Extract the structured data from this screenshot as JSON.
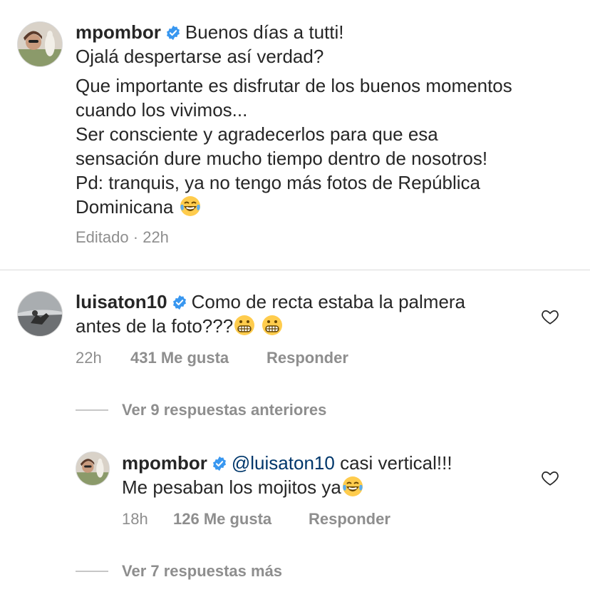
{
  "caption": {
    "username": "mpombor",
    "lines": [
      "Buenos días a tutti!",
      "Ojalá despertarse así verdad?",
      "Que importante es disfrutar de los buenos momentos",
      "cuando los vivimos...",
      "Ser consciente y agradecerlos para que esa",
      "sensación dure mucho tiempo dentro de nosotros!",
      "Pd: tranquis, ya no tengo más fotos de República",
      "Dominicana"
    ],
    "edited": "Editado",
    "separator": "·",
    "time": "22h"
  },
  "comment1": {
    "username": "luisaton10",
    "line1": "Como de recta estaba la palmera",
    "line2": "antes de la foto???",
    "time": "22h",
    "likes": "431 Me gusta",
    "reply": "Responder"
  },
  "view_previous": "Ver 9 respuestas anteriores",
  "reply1": {
    "username": "mpombor",
    "mention": "@luisaton10",
    "line1_rest": "casi vertical!!!",
    "line2": "Me pesaban los mojitos ya",
    "time": "18h",
    "likes": "126 Me gusta",
    "reply": "Responder"
  },
  "view_more": "Ver 7 respuestas más",
  "icons": {
    "verified": "verified-badge-icon",
    "heart": "heart-outline-icon",
    "laughing": "face-with-tears-of-joy-emoji",
    "grimacing": "grimacing-face-emoji"
  },
  "colors": {
    "text": "#262626",
    "secondary": "#8e8e8e",
    "verified": "#3897f0",
    "mention": "#00376b"
  }
}
